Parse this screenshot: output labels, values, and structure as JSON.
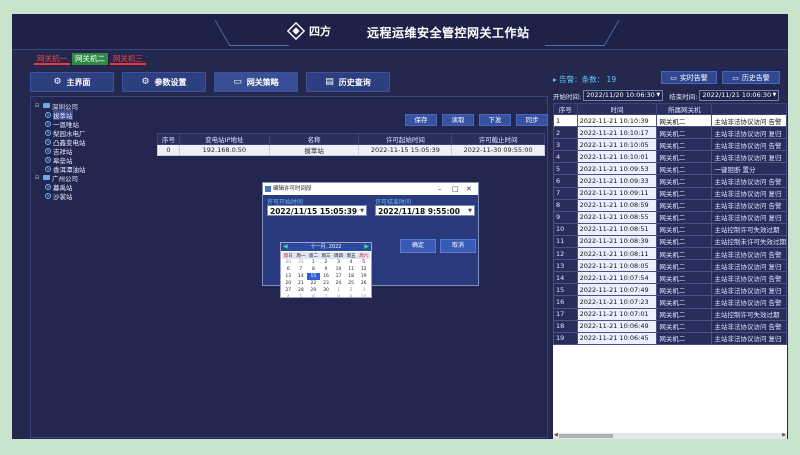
{
  "header": {
    "logo_text": "四方",
    "title": "远程运维安全管控网关工作站"
  },
  "gateway_tabs": [
    {
      "label": "网关机一",
      "active": false
    },
    {
      "label": "网关机二",
      "active": true
    },
    {
      "label": "网关机三",
      "active": false
    }
  ],
  "nav": [
    {
      "label": "主界面",
      "icon": "gear-icon"
    },
    {
      "label": "参数设置",
      "icon": "gear-icon"
    },
    {
      "label": "网关策略",
      "icon": "monitor-icon"
    },
    {
      "label": "历史查询",
      "icon": "document-icon"
    }
  ],
  "tree": [
    {
      "label": "深圳公司",
      "level": 0,
      "type": "group"
    },
    {
      "label": "拔萃站",
      "level": 1,
      "type": "station",
      "selected": true
    },
    {
      "label": "一恩唯站",
      "level": 1,
      "type": "station"
    },
    {
      "label": "梨园水电厂",
      "level": 1,
      "type": "station"
    },
    {
      "label": "凸鑫变电站",
      "level": 1,
      "type": "station"
    },
    {
      "label": "吉祥站",
      "level": 1,
      "type": "station"
    },
    {
      "label": "皋垒站",
      "level": 1,
      "type": "station"
    },
    {
      "label": "香洱潭油站",
      "level": 1,
      "type": "station"
    },
    {
      "label": "广州公司",
      "level": 0,
      "type": "group"
    },
    {
      "label": "暮禹站",
      "level": 1,
      "type": "station"
    },
    {
      "label": "沙裳站",
      "level": 1,
      "type": "station"
    }
  ],
  "actions": {
    "save": "保存",
    "read": "读取",
    "download": "下发",
    "sync": "同步"
  },
  "gw_table": {
    "columns": [
      "序号",
      "变电站IP地址",
      "名称",
      "许可起始时间",
      "许可截止时间"
    ],
    "rows": [
      [
        "0",
        "192.168.0.50",
        "拔萃站",
        "2022-11-15 15:05:39",
        "2022-11-30 09:55:00"
      ]
    ]
  },
  "dialog": {
    "title": "编辑许可时间段",
    "start_label": "许可开始时间",
    "start_value": "2022/11/15 15:05:39",
    "end_label": "许可结束时间",
    "end_value": "2022/11/18 9:55:00",
    "ok": "确定",
    "cancel": "取消"
  },
  "calendar": {
    "header": "十一月, 2022",
    "weekdays": [
      "周日",
      "周一",
      "周二",
      "周三",
      "周四",
      "周五",
      "周六"
    ],
    "weeks": [
      [
        "30",
        "31",
        "1",
        "2",
        "3",
        "4",
        "5"
      ],
      [
        "6",
        "7",
        "8",
        "9",
        "10",
        "11",
        "12"
      ],
      [
        "13",
        "14",
        "15",
        "16",
        "17",
        "18",
        "19"
      ],
      [
        "20",
        "21",
        "22",
        "23",
        "24",
        "25",
        "26"
      ],
      [
        "27",
        "28",
        "29",
        "30",
        "1",
        "2",
        "3"
      ],
      [
        "4",
        "5",
        "6",
        "7",
        "8",
        "9",
        "10"
      ]
    ],
    "selected_day": "15"
  },
  "alarm": {
    "label": "告警：条数：",
    "count": "19",
    "realtime_btn": "实时告警",
    "history_btn": "历史告警",
    "start_label": "开始时间:",
    "start_value": "2022/11/20 10:06:30",
    "end_label": "结束时间:",
    "end_value": "2022/11/21 10:06:30",
    "columns": [
      "序号",
      "时间",
      "所属网关机",
      ""
    ],
    "rows": [
      [
        "1",
        "2022-11-21 10:10:39",
        "网关机二",
        "主站非法协议访问 告警"
      ],
      [
        "2",
        "2022-11-21 10:10:17",
        "网关机二",
        "主站非法协议访问 复归"
      ],
      [
        "3",
        "2022-11-21 10:10:05",
        "网关机二",
        "主站非法协议访问 告警"
      ],
      [
        "4",
        "2022-11-21 10:10:01",
        "网关机二",
        "主站非法协议访问 复归"
      ],
      [
        "5",
        "2022-11-21 10:09:53",
        "网关机二",
        "一键阻断 置分"
      ],
      [
        "6",
        "2022-11-21 10:09:33",
        "网关机二",
        "主站非法协议访问 告警"
      ],
      [
        "7",
        "2022-11-21 10:09:11",
        "网关机二",
        "主站非法协议访问 复归"
      ],
      [
        "8",
        "2022-11-21 10:08:59",
        "网关机二",
        "主站非法协议访问 告警"
      ],
      [
        "9",
        "2022-11-21 10:08:55",
        "网关机二",
        "主站非法协议访问 复归"
      ],
      [
        "10",
        "2022-11-21 10:08:51",
        "网关机二",
        "主站控制许可失效过期"
      ],
      [
        "11",
        "2022-11-21 10:08:39",
        "网关机二",
        "主站控制未许可失效过期"
      ],
      [
        "12",
        "2022-11-21 10:08:11",
        "网关机二",
        "主站非法协议访问 告警"
      ],
      [
        "13",
        "2022-11-21 10:08:05",
        "网关机二",
        "主站非法协议访问 复归"
      ],
      [
        "14",
        "2022-11-21 10:07:54",
        "网关机二",
        "主站非法协议访问 告警"
      ],
      [
        "15",
        "2022-11-21 10:07:49",
        "网关机二",
        "主站非法协议访问 复归"
      ],
      [
        "16",
        "2022-11-21 10:07:23",
        "网关机二",
        "主站非法协议访问 告警"
      ],
      [
        "17",
        "2022-11-21 10:07:01",
        "网关机二",
        "主站控制许可失效过期"
      ],
      [
        "18",
        "2022-11-21 10:06:49",
        "网关机二",
        "主站非法协议访问 告警"
      ],
      [
        "19",
        "2022-11-21 10:06:45",
        "网关机二",
        "主站非法协议访问 复归"
      ]
    ]
  }
}
